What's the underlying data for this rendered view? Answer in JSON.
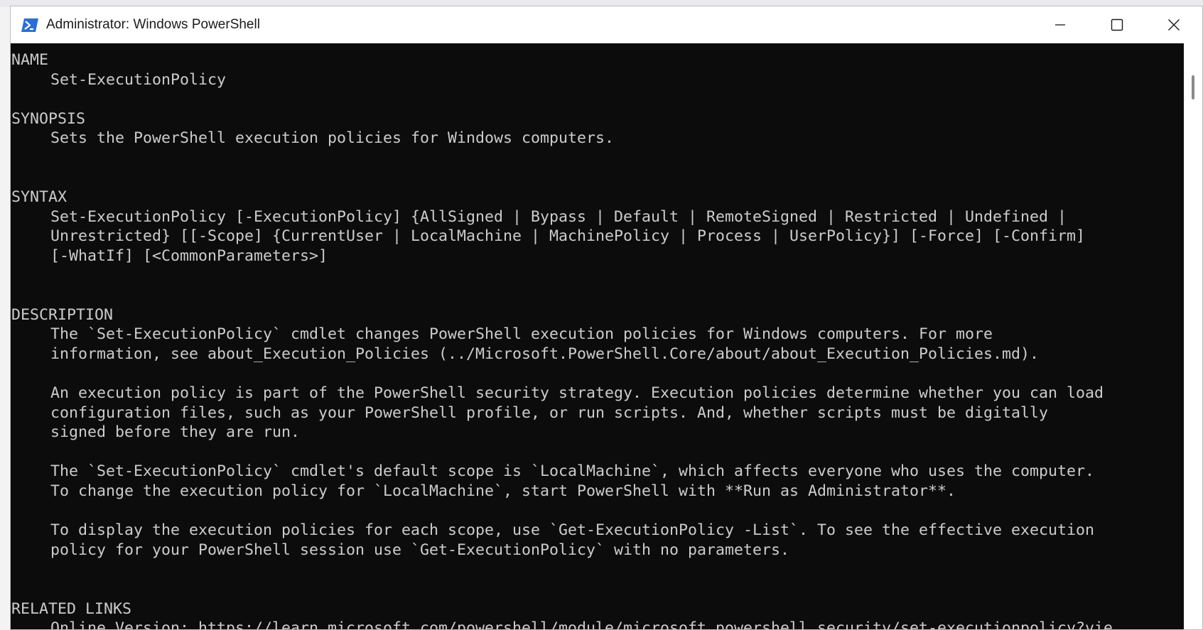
{
  "window": {
    "title": "Administrator: Windows PowerShell",
    "icon": "powershell-icon",
    "controls": {
      "minimize_icon": "minimize-icon",
      "maximize_icon": "maximize-icon",
      "close_icon": "close-icon"
    }
  },
  "console": {
    "lines": [
      {
        "indent": false,
        "text": "NAME"
      },
      {
        "indent": true,
        "text": "Set-ExecutionPolicy"
      },
      {
        "indent": false,
        "text": ""
      },
      {
        "indent": false,
        "text": "SYNOPSIS"
      },
      {
        "indent": true,
        "text": "Sets the PowerShell execution policies for Windows computers."
      },
      {
        "indent": false,
        "text": ""
      },
      {
        "indent": false,
        "text": ""
      },
      {
        "indent": false,
        "text": "SYNTAX"
      },
      {
        "indent": true,
        "text": "Set-ExecutionPolicy [-ExecutionPolicy] {AllSigned | Bypass | Default | RemoteSigned | Restricted | Undefined |"
      },
      {
        "indent": true,
        "text": "Unrestricted} [[-Scope] {CurrentUser | LocalMachine | MachinePolicy | Process | UserPolicy}] [-Force] [-Confirm]"
      },
      {
        "indent": true,
        "text": "[-WhatIf] [<CommonParameters>]"
      },
      {
        "indent": false,
        "text": ""
      },
      {
        "indent": false,
        "text": ""
      },
      {
        "indent": false,
        "text": "DESCRIPTION"
      },
      {
        "indent": true,
        "text": "The `Set-ExecutionPolicy` cmdlet changes PowerShell execution policies for Windows computers. For more"
      },
      {
        "indent": true,
        "text": "information, see about_Execution_Policies (../Microsoft.PowerShell.Core/about/about_Execution_Policies.md)."
      },
      {
        "indent": false,
        "text": ""
      },
      {
        "indent": true,
        "text": "An execution policy is part of the PowerShell security strategy. Execution policies determine whether you can load"
      },
      {
        "indent": true,
        "text": "configuration files, such as your PowerShell profile, or run scripts. And, whether scripts must be digitally"
      },
      {
        "indent": true,
        "text": "signed before they are run."
      },
      {
        "indent": false,
        "text": ""
      },
      {
        "indent": true,
        "text": "The `Set-ExecutionPolicy` cmdlet's default scope is `LocalMachine`, which affects everyone who uses the computer."
      },
      {
        "indent": true,
        "text": "To change the execution policy for `LocalMachine`, start PowerShell with **Run as Administrator**."
      },
      {
        "indent": false,
        "text": ""
      },
      {
        "indent": true,
        "text": "To display the execution policies for each scope, use `Get-ExecutionPolicy -List`. To see the effective execution"
      },
      {
        "indent": true,
        "text": "policy for your PowerShell session use `Get-ExecutionPolicy` with no parameters."
      },
      {
        "indent": false,
        "text": ""
      },
      {
        "indent": false,
        "text": ""
      },
      {
        "indent": false,
        "text": "RELATED LINKS"
      },
      {
        "indent": true,
        "text": "Online Version: https://learn.microsoft.com/powershell/module/microsoft.powershell.security/set-executionpolicy?vie"
      }
    ]
  },
  "colors": {
    "console_bg": "#0c0c0c",
    "console_fg": "#cccccc",
    "titlebar_bg": "#ffffff",
    "icon_blue": "#2a6fd6"
  }
}
